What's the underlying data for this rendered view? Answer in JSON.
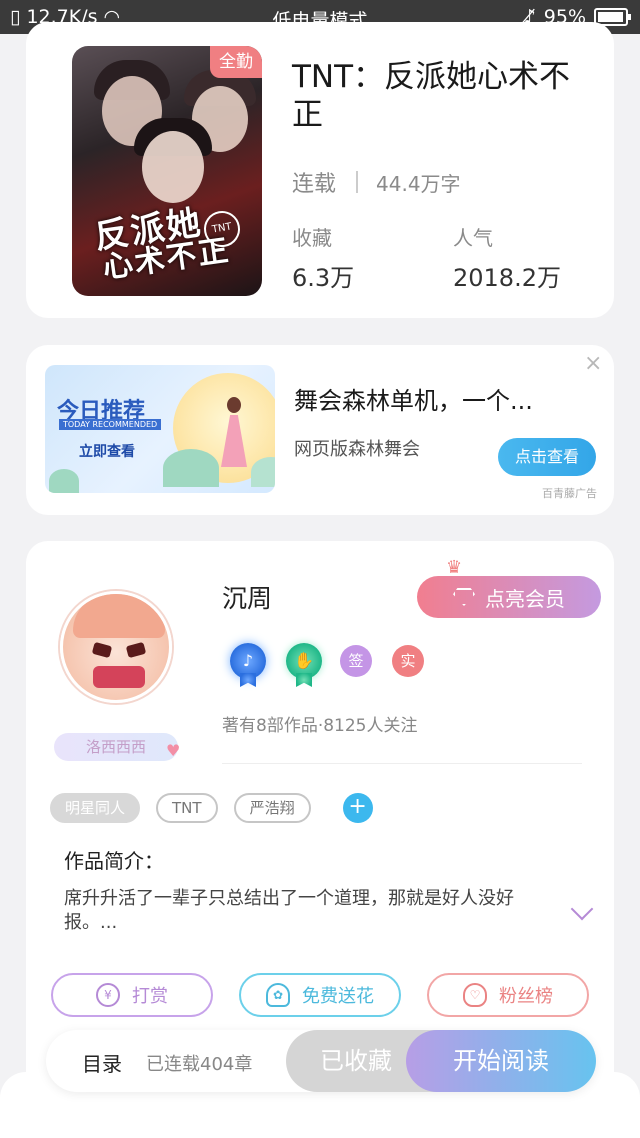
{
  "status_bar": {
    "speed": "12.7K/s",
    "mode": "低电量模式",
    "battery": "95%",
    "battery_level": 0.95
  },
  "book": {
    "badge": "全勤",
    "title": "TNT：反派她心术不正",
    "status": "连载",
    "word_count": "44.4万字",
    "favorites_label": "收藏",
    "favorites_value": "6.3万",
    "popularity_label": "人气",
    "popularity_value": "2018.2万",
    "cover_title_line1": "反派她",
    "cover_title_line2": "心术不正",
    "cover_seal": "TNT"
  },
  "ad": {
    "banner_title": "今日推荐",
    "banner_sub": "TODAY RECOMMENDED",
    "banner_cta": "立即查看",
    "title": "舞会森林单机，一个...",
    "description": "网页版森林舞会",
    "button": "点击查看",
    "close": "×",
    "source": "百青藤广告"
  },
  "author": {
    "name": "沉周",
    "name_tag": "洛西西西",
    "vip_button": "点亮会员",
    "badge_sign": "签",
    "badge_real": "实",
    "stats": "著有8部作品·8125人关注"
  },
  "tags": [
    "明星同人",
    "TNT",
    "严浩翔"
  ],
  "intro": {
    "label": "作品简介：",
    "text": "席升升活了一辈子只总结出了一个道理，那就是好人没好报。..."
  },
  "actions": {
    "reward": "打赏",
    "flower": "免费送花",
    "fans": "粉丝榜"
  },
  "bottom_bar": {
    "catalog": "目录",
    "chapters": "已连载404章",
    "collected": "已收藏",
    "read": "开始阅读"
  }
}
